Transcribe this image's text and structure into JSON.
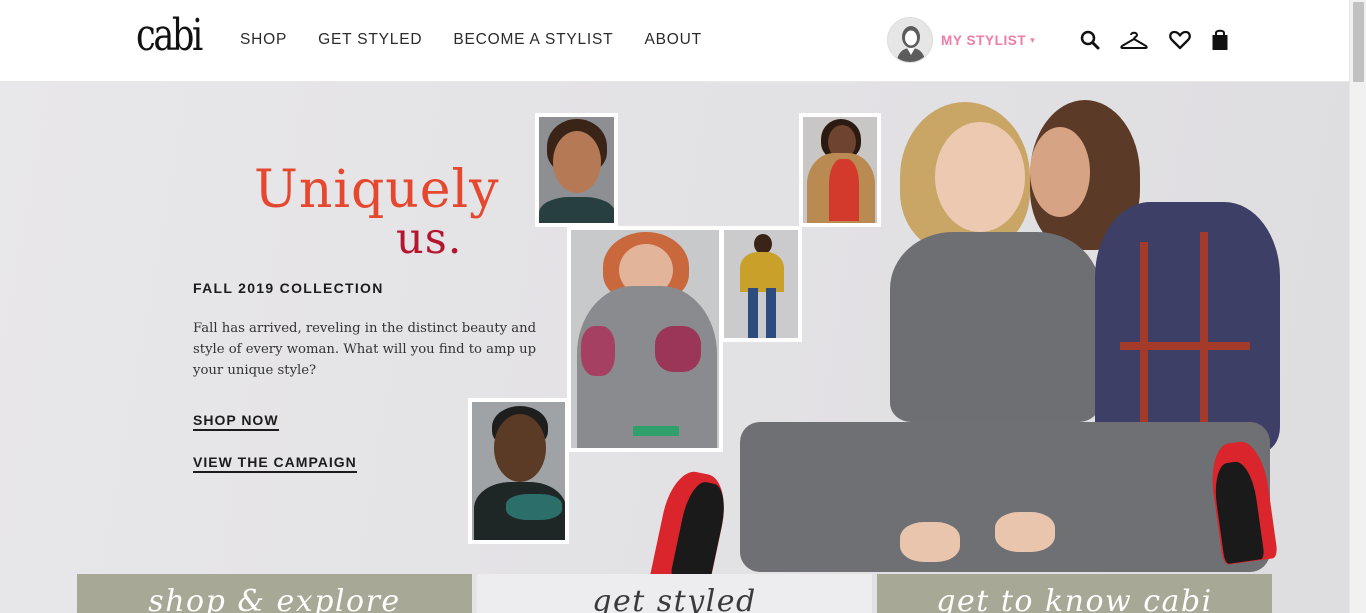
{
  "header": {
    "logo_text": "cabi",
    "nav": [
      "SHOP",
      "GET STYLED",
      "BECOME A STYLIST",
      "ABOUT"
    ],
    "stylist_label": "MY STYLIST",
    "stylist_caret": "▾",
    "icons": [
      "search-icon",
      "hanger-icon",
      "heart-icon",
      "shopping-bag-icon"
    ]
  },
  "hero": {
    "headline_1": "Uniquely",
    "headline_2": "us.",
    "collection": "FALL 2019 COLLECTION",
    "description": "Fall has arrived, reveling in the distinct beauty and style of every woman. What will you find to amp up your unique style?",
    "cta_shop": "SHOP NOW",
    "cta_campaign": "VIEW THE CAMPAIGN"
  },
  "cards": [
    {
      "label": "shop & explore",
      "bg": "#a7a895",
      "color": "#ffffff"
    },
    {
      "label": "get styled",
      "bg": "#edecee",
      "color": "#3a3a3a"
    },
    {
      "label": "get to know cabi",
      "bg": "#a7a895",
      "color": "#ffffff"
    }
  ],
  "colors": {
    "accent_pink": "#f07ba8",
    "headline_orange": "#e5472f",
    "headline_red": "#b5162f",
    "card_olive": "#a7a895"
  }
}
